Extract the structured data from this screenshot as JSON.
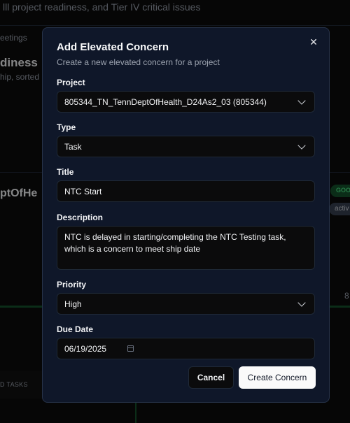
{
  "background": {
    "subtitle": "lll project readiness, and Tier IV critical issues",
    "tab_label": "eetings",
    "card_title": "diness",
    "card_subtitle": "hip, sorted",
    "project_name": "ptOfHe",
    "badge_good": "GOO",
    "badge_active": "activ",
    "right_number": "8",
    "tasks_label": "D TASKS"
  },
  "modal": {
    "title": "Add Elevated Concern",
    "description": "Create a new elevated concern for a project",
    "close_icon": "close-icon",
    "fields": {
      "project": {
        "label": "Project",
        "value": "805344_TN_TennDeptOfHealth_D24As2_03 (805344)"
      },
      "type": {
        "label": "Type",
        "value": "Task"
      },
      "title": {
        "label": "Title",
        "value": "NTC Start"
      },
      "description": {
        "label": "Description",
        "value": "NTC is delayed in starting/completing the NTC Testing task, which is a concern to meet ship date"
      },
      "priority": {
        "label": "Priority",
        "value": "High"
      },
      "due_date": {
        "label": "Due Date",
        "value": "06/19/2025"
      }
    },
    "buttons": {
      "cancel": "Cancel",
      "create": "Create Concern"
    }
  }
}
